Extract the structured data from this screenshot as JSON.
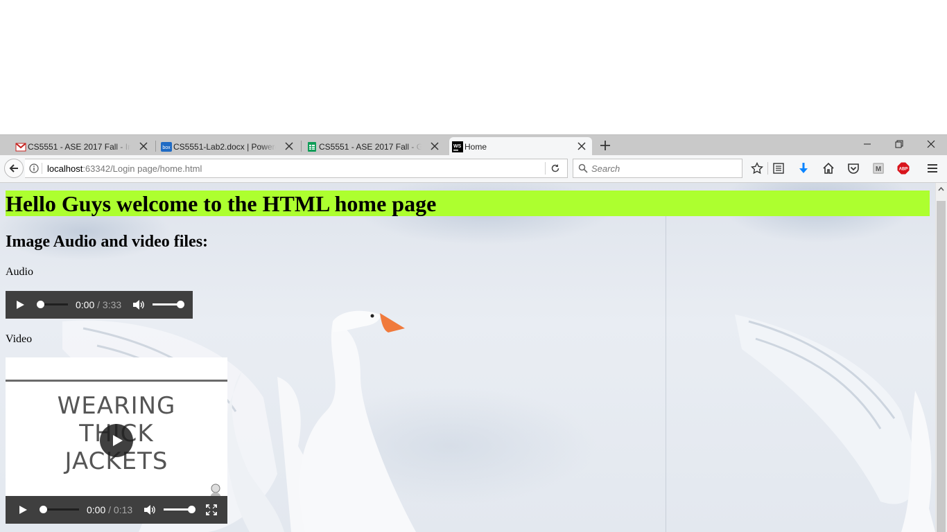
{
  "browser": {
    "tabs": [
      {
        "label": "CS5551 - ASE 2017 Fall - Invit",
        "icon": "gmail-icon",
        "active": false
      },
      {
        "label": "CS5551-Lab2.docx | Powered",
        "icon": "box-icon",
        "active": false
      },
      {
        "label": "CS5551 - ASE 2017 Fall - Goo",
        "icon": "google-sheets-icon",
        "active": false
      },
      {
        "label": "Home",
        "icon": "webstorm-icon",
        "active": true
      }
    ],
    "url_host": "localhost",
    "url_rest": ":63342/Login page/home.html",
    "search_placeholder": "Search",
    "abp_label": "ABP"
  },
  "page": {
    "heading": "Hello Guys welcome to the HTML home page",
    "subheading": "Image Audio and video files:",
    "audio_label": "Audio",
    "video_label": "Video",
    "audio": {
      "current": "0:00",
      "duration": " / 3:33",
      "progress": 0,
      "volume": 1
    },
    "video": {
      "poster_text": [
        "WEARING",
        "THICK",
        "JACKETS"
      ],
      "current": "0:00",
      "duration": " / 0:13",
      "progress": 0,
      "volume": 1
    }
  },
  "colors": {
    "heading_bg": "#adff2f",
    "controls_bg": "#3f3f3f",
    "abp_red": "#d8141c",
    "download_blue": "#0a84ff"
  }
}
